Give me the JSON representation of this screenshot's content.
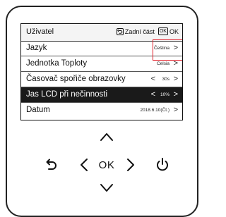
{
  "header": {
    "title": "Uživatel",
    "back_label": "Zadní část",
    "ok_icon": "OK",
    "ok_label": "OK"
  },
  "menu": [
    {
      "label": "Jazyk",
      "value": "Čeština",
      "selected": false
    },
    {
      "label": "Jednotka Toploty",
      "value": "Celsia",
      "selected": false
    },
    {
      "label": "Časovač spořiče obrazovky",
      "value": "30s",
      "selected": false
    },
    {
      "label": "Jas LCD při nečinnosti",
      "value": "10%",
      "selected": true
    },
    {
      "label": "Datum",
      "value": "2018.6.10(Čt.)",
      "selected": false
    }
  ],
  "controls": {
    "ok_label": "OK",
    "up_icon": "chevron-up-icon",
    "down_icon": "chevron-down-icon",
    "left_icon": "chevron-left-icon",
    "right_icon": "chevron-right-icon",
    "back_icon": "back-arrow-icon",
    "power_icon": "power-icon"
  },
  "colors": {
    "selected_row": "#1a1a1a",
    "highlight_box": "#e0202a"
  }
}
